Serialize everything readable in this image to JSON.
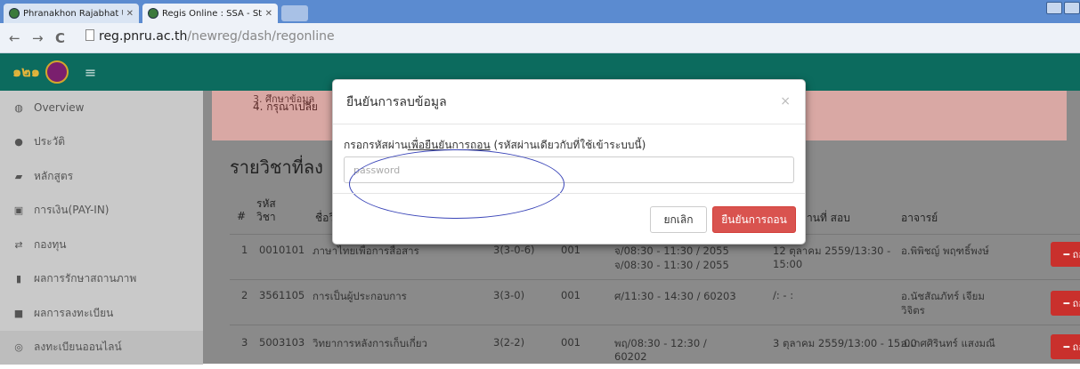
{
  "browser": {
    "tabs": [
      {
        "label": "Phranakhon Rajabhat Univer",
        "active": false
      },
      {
        "label": "Regis Online : SSA - Student",
        "active": true
      }
    ],
    "url_host": "reg.pnru.ac.th",
    "url_path": "/newreg/dash/regonline"
  },
  "sidebar": {
    "logo_text": "๑๒๑",
    "items": [
      {
        "label": "Overview",
        "icon": "dashboard-icon"
      },
      {
        "label": "ประวัติ",
        "icon": "user-icon"
      },
      {
        "label": "หลักสูตร",
        "icon": "book-icon"
      },
      {
        "label": "การเงิน(PAY-IN)",
        "icon": "money-icon"
      },
      {
        "label": "กองทุน",
        "icon": "exchange-icon"
      },
      {
        "label": "ผลการรักษาสถานภาพ",
        "icon": "file-icon"
      },
      {
        "label": "ผลการลงทะเบียน",
        "icon": "list-icon"
      },
      {
        "label": "ลงทะเบียนออนไลน์",
        "icon": "globe-icon"
      }
    ]
  },
  "alert": {
    "line3": "3. ศึกษาข้อมูล",
    "line4": "4. กรุณาเปลี่ย"
  },
  "main": {
    "section_title": "รายวิชาที่ลง",
    "table_headers": {
      "num": "#",
      "code": "รหัส\nวิชา",
      "name": "ชื่อวิ",
      "exam": "านที่ สอบ",
      "teacher": "อาจารย์"
    },
    "rows": [
      {
        "num": "1",
        "code": "0010101",
        "name": "ภาษาไทยเพื่อการสื่อสาร",
        "credit": "3(3-0-6)",
        "section": "001",
        "time1": "จ/08:30 - 11:30 / 2055",
        "time2": "จ/08:30 - 11:30 / 2055",
        "exam1": "12 ตุลาคม 2559/13:30 -",
        "exam2": "15:00",
        "teacher1": "อ.พิพิชญ์ พฤฑธิ์พงษ์",
        "teacher2": "",
        "button": "ถอน"
      },
      {
        "num": "2",
        "code": "3561105",
        "name": "การเป็นผู้ประกอบการ",
        "credit": "3(3-0)",
        "section": "001",
        "time1": "ศ/11:30 - 14:30 / 60203",
        "time2": "",
        "exam1": "/: - :",
        "exam2": "",
        "teacher1": "อ.นัชสัณภัทร์ เจียม",
        "teacher2": "วิจิตร",
        "button": "ถอน"
      },
      {
        "num": "3",
        "code": "5003103",
        "name": "วิทยาการหลังการเก็บเกี่ยว",
        "credit": "3(2-2)",
        "section": "001",
        "time1": "พฤ/08:30 - 12:30 /",
        "time2": "60202",
        "exam1": "3 ตุลาคม 2559/13:00 - 15:00",
        "exam2": "",
        "teacher1": "อ.เกศศิรินทร์ แสงมณี",
        "teacher2": "",
        "button": "ถอน"
      }
    ]
  },
  "modal": {
    "title": "ยืนยันการลบข้อมูล",
    "close": "×",
    "label_prefix": "กรอกรหัสผ่าน",
    "label_underlined": "เพื่อยืนยันการถอน",
    "label_suffix": " (รหัสผ่านเดียวกับที่ใช้เข้าระบบนี้)",
    "input_placeholder": "password",
    "cancel_label": "ยกเลิก",
    "confirm_label": "ยืนยันการถอน"
  },
  "colors": {
    "brand_green": "#0c6b5e",
    "danger": "#d9534f",
    "annotation": "#3a45b8"
  }
}
